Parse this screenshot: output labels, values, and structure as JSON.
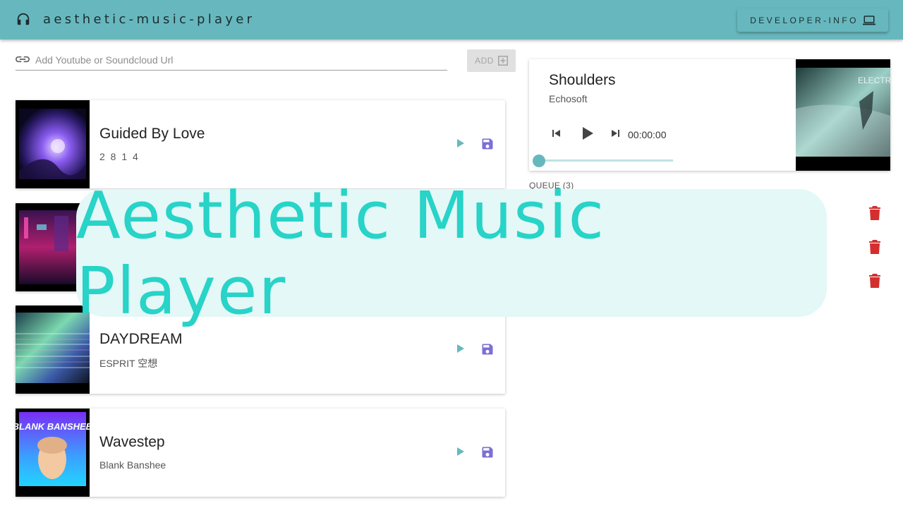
{
  "app": {
    "title": "aesthetic-music-player",
    "developer_button": "DEVELOPER-INFO",
    "colors": {
      "primary": "#67b8be",
      "accent_purple": "#7b6fd6",
      "danger": "#d32f2f",
      "overlay_text": "#28d3c7"
    }
  },
  "url_input": {
    "placeholder": "Add Youtube or Soundcloud Url",
    "value": ""
  },
  "add_button": {
    "label": "ADD"
  },
  "tracks": [
    {
      "title": "Guided By Love",
      "artist": "2 8 1 4",
      "cover_icon": "album-art"
    },
    {
      "title": "",
      "artist": "",
      "cover_icon": "album-art"
    },
    {
      "title": "DAYDREAM",
      "artist": "ESPRIT 空想",
      "cover_icon": "album-art"
    },
    {
      "title": "Wavestep",
      "artist": "Blank Banshee",
      "cover_icon": "album-art",
      "cover_text": "BLANK BANSHEE"
    }
  ],
  "now_playing": {
    "title": "Shoulders",
    "artist": "Echosoft",
    "time": "00:00:00",
    "progress": 0,
    "cover_text": "ELECTR"
  },
  "queue": {
    "label": "QUEUE (3)",
    "count": 3
  },
  "overlay": {
    "title": "Aesthetic Music Player"
  }
}
